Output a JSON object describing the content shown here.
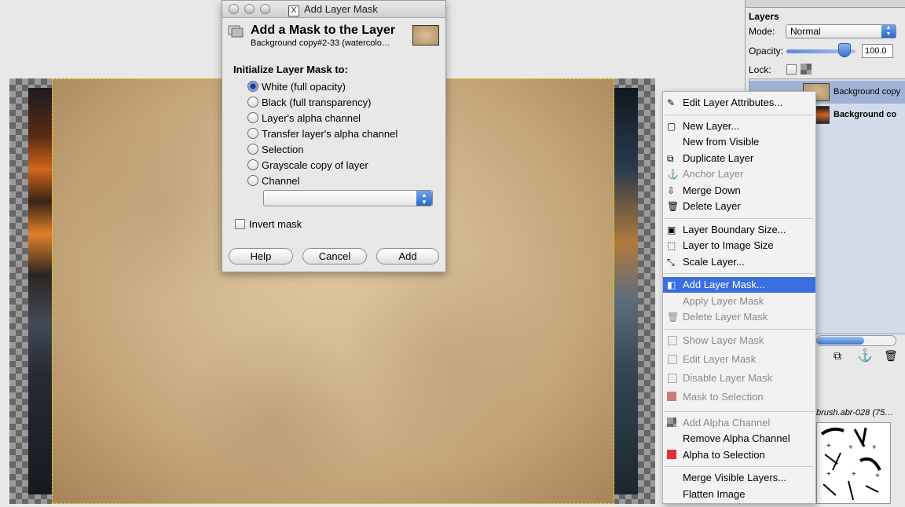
{
  "dialog": {
    "window_title": "Add Layer Mask",
    "header_title": "Add a Mask to the Layer",
    "header_subtitle": "Background copy#2-33 (watercolo…",
    "section_label": "Initialize Layer Mask to:",
    "options": [
      {
        "label": "White (full opacity)",
        "selected": true
      },
      {
        "label": "Black (full transparency)",
        "selected": false
      },
      {
        "label": "Layer's alpha channel",
        "selected": false
      },
      {
        "label": "Transfer layer's alpha channel",
        "selected": false
      },
      {
        "label": "Selection",
        "selected": false
      },
      {
        "label": "Grayscale copy of layer",
        "selected": false
      },
      {
        "label": "Channel",
        "selected": false
      }
    ],
    "channel_value": "",
    "invert_label": "Invert mask",
    "buttons": {
      "help": "Help",
      "cancel": "Cancel",
      "add": "Add"
    }
  },
  "layers_panel": {
    "title": "Layers",
    "mode_label": "Mode:",
    "mode_value": "Normal",
    "opacity_label": "Opacity:",
    "opacity_value": "100.0",
    "opacity_percent": 100,
    "lock_label": "Lock:",
    "layers": [
      {
        "name": "Background copy",
        "selected": true
      },
      {
        "name": "Background co",
        "selected": false
      }
    ],
    "brush_label": "brush.abr-028 (75…"
  },
  "context_menu": {
    "groups": [
      [
        {
          "label": "Edit Layer Attributes...",
          "icon": "edit-attributes-icon",
          "disabled": false
        }
      ],
      [
        {
          "label": "New Layer...",
          "icon": "new-layer-icon",
          "disabled": false
        },
        {
          "label": "New from Visible",
          "icon": "",
          "disabled": false
        },
        {
          "label": "Duplicate Layer",
          "icon": "duplicate-icon",
          "disabled": false
        },
        {
          "label": "Anchor Layer",
          "icon": "anchor-icon",
          "disabled": true
        },
        {
          "label": "Merge Down",
          "icon": "merge-down-icon",
          "disabled": false
        },
        {
          "label": "Delete Layer",
          "icon": "trash-icon",
          "disabled": false
        }
      ],
      [
        {
          "label": "Layer Boundary Size...",
          "icon": "boundary-icon",
          "disabled": false
        },
        {
          "label": "Layer to Image Size",
          "icon": "image-size-icon",
          "disabled": false
        },
        {
          "label": "Scale Layer...",
          "icon": "scale-icon",
          "disabled": false
        }
      ],
      [
        {
          "label": "Add Layer Mask...",
          "icon": "add-mask-icon",
          "disabled": false,
          "highlighted": true
        },
        {
          "label": "Apply Layer Mask",
          "icon": "",
          "disabled": true
        },
        {
          "label": "Delete Layer Mask",
          "icon": "trash-icon",
          "disabled": true
        }
      ],
      [
        {
          "label": "Show Layer Mask",
          "icon": "checkbox-icon",
          "disabled": true
        },
        {
          "label": "Edit Layer Mask",
          "icon": "checkbox-icon",
          "disabled": true
        },
        {
          "label": "Disable Layer Mask",
          "icon": "checkbox-icon",
          "disabled": true
        },
        {
          "label": "Mask to Selection",
          "icon": "mask-selection-icon",
          "disabled": true
        }
      ],
      [
        {
          "label": "Add Alpha Channel",
          "icon": "alpha-icon",
          "disabled": true
        },
        {
          "label": "Remove Alpha Channel",
          "icon": "",
          "disabled": false
        },
        {
          "label": "Alpha to Selection",
          "icon": "alpha-selection-icon",
          "disabled": false
        }
      ],
      [
        {
          "label": "Merge Visible Layers...",
          "icon": "",
          "disabled": false
        },
        {
          "label": "Flatten Image",
          "icon": "",
          "disabled": false
        }
      ]
    ]
  },
  "colors": {
    "menu_highlight": "#3b6ee0",
    "selection_border": "#d8d300",
    "accent_blue": "#2c68c9"
  }
}
